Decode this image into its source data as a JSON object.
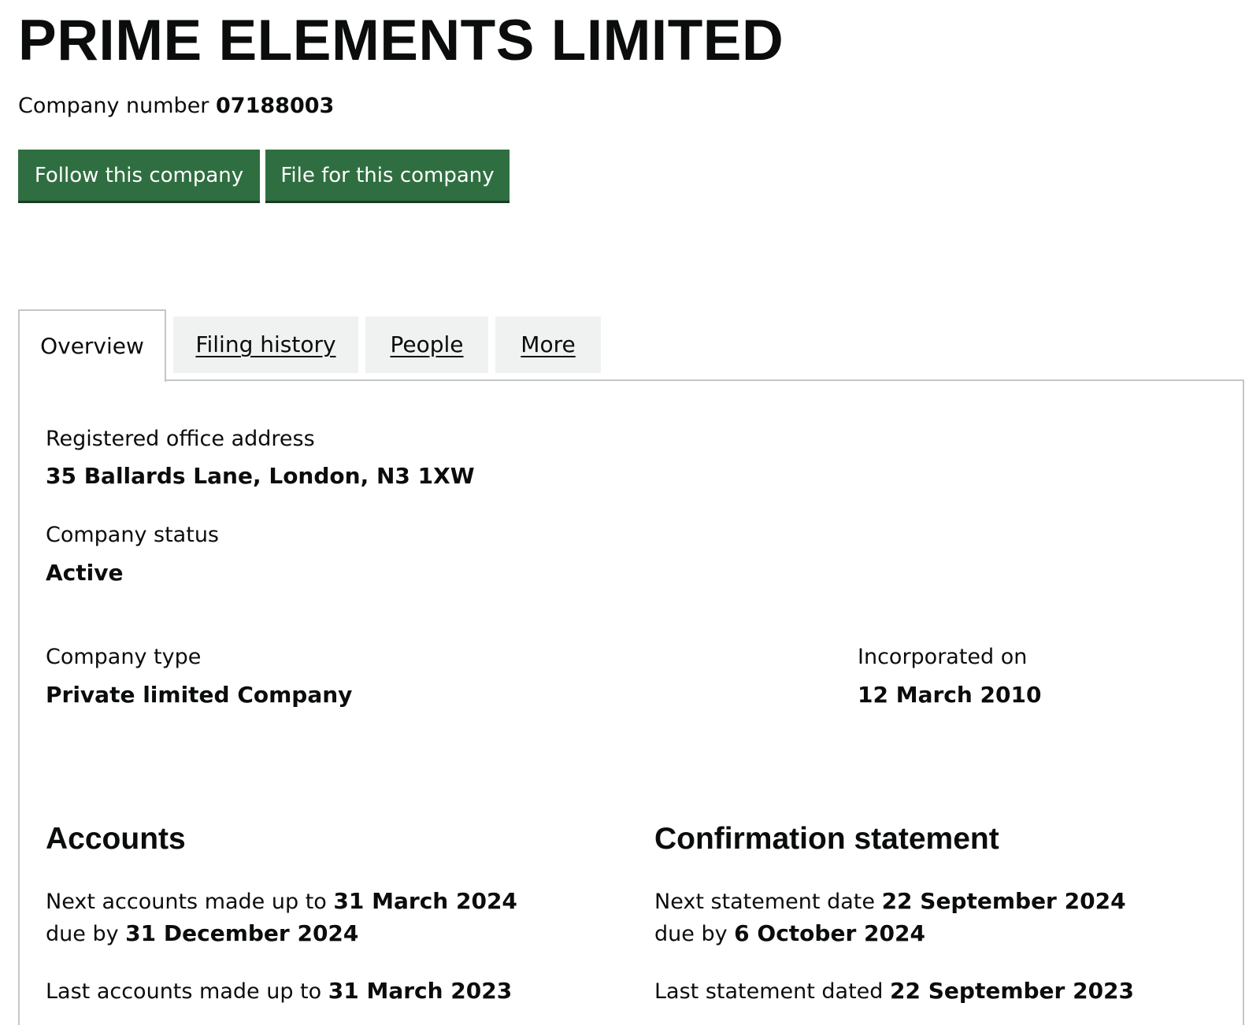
{
  "company": {
    "name": "PRIME ELEMENTS LIMITED",
    "number_label": "Company number",
    "number": "07188003"
  },
  "actions": {
    "follow_label": "Follow this company",
    "file_label": "File for this company"
  },
  "tabs": [
    {
      "label": "Overview",
      "active": true
    },
    {
      "label": "Filing history",
      "active": false
    },
    {
      "label": "People",
      "active": false
    },
    {
      "label": "More",
      "active": false
    }
  ],
  "overview": {
    "registered_office": {
      "label": "Registered office address",
      "value": "35 Ballards Lane, London, N3 1XW"
    },
    "status": {
      "label": "Company status",
      "value": "Active"
    },
    "type": {
      "label": "Company type",
      "value": "Private limited Company"
    },
    "incorporated": {
      "label": "Incorporated on",
      "value": "12 March 2010"
    }
  },
  "accounts": {
    "heading": "Accounts",
    "next_label": "Next accounts made up to",
    "next_date": "31 March 2024",
    "due_label": "due by",
    "due_date": "31 December 2024",
    "last_label": "Last accounts made up to",
    "last_date": "31 March 2023"
  },
  "confirmation": {
    "heading": "Confirmation statement",
    "next_label": "Next statement date",
    "next_date": "22 September 2024",
    "due_label": "due by",
    "due_date": "6 October 2024",
    "last_label": "Last statement dated",
    "last_date": "22 September 2023"
  },
  "colors": {
    "button_green": "#2f6e40",
    "text": "#0b0c0c",
    "tab_background": "#f0f1f1",
    "border": "#c4c6c8"
  }
}
